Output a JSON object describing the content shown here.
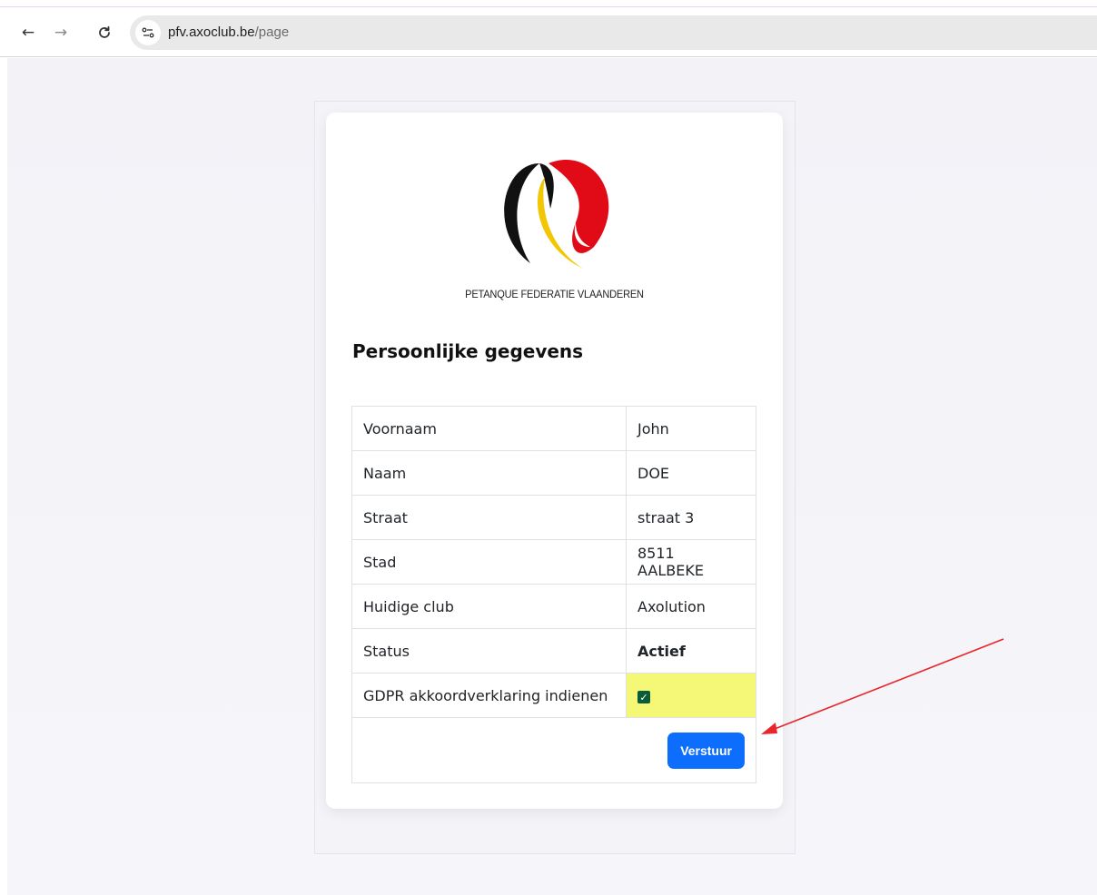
{
  "browser": {
    "url_host": "pfv.axoclub.be",
    "url_path": "/page"
  },
  "logo": {
    "caption": "PETANQUE FEDERATIE VLAANDEREN"
  },
  "section_title": "Persoonlijke gegevens",
  "rows": [
    {
      "label": "Voornaam",
      "value": "John"
    },
    {
      "label": "Naam",
      "value": "DOE"
    },
    {
      "label": "Straat",
      "value": "straat 3"
    },
    {
      "label": "Stad",
      "value": "8511 AALBEKE"
    },
    {
      "label": "Huidige club",
      "value": "Axolution"
    },
    {
      "label": "Status",
      "value": "Actief"
    }
  ],
  "gdpr": {
    "label": "GDPR akkoordverklaring indienen",
    "checked": true
  },
  "submit_label": "Verstuur",
  "colors": {
    "highlight": "#f5f777",
    "button": "#0d6efd",
    "arrow": "#e8262b"
  }
}
